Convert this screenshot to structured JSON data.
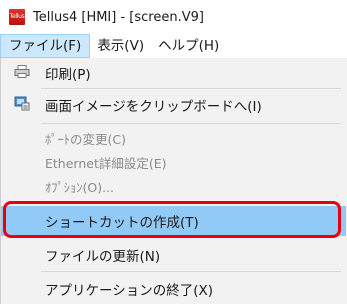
{
  "window": {
    "app_icon_text": "Tellus",
    "title": "Tellus4 [HMI] - [screen.V9]"
  },
  "menubar": {
    "items": [
      "ファイル(F)",
      "表示(V)",
      "ヘルプ(H)"
    ]
  },
  "file_menu": {
    "print": "印刷(P)",
    "copy_image": "画面イメージをクリップボードへ(I)",
    "port_change": "ﾎﾟｰﾄの変更(C)",
    "ethernet": "Ethernet詳細設定(E)",
    "options": "ｵﾌﾟｼｮﾝ(O)...",
    "create_shortcut": "ショートカットの作成(T)",
    "update_file": "ファイルの更新(N)",
    "exit": "アプリケーションの終了(X)"
  },
  "colors": {
    "menu_active_bg": "#cce8ff",
    "item_highlight_bg": "#91c9f7",
    "callout_border": "#e8000b",
    "dropdown_bg": "#f2f2f2"
  }
}
